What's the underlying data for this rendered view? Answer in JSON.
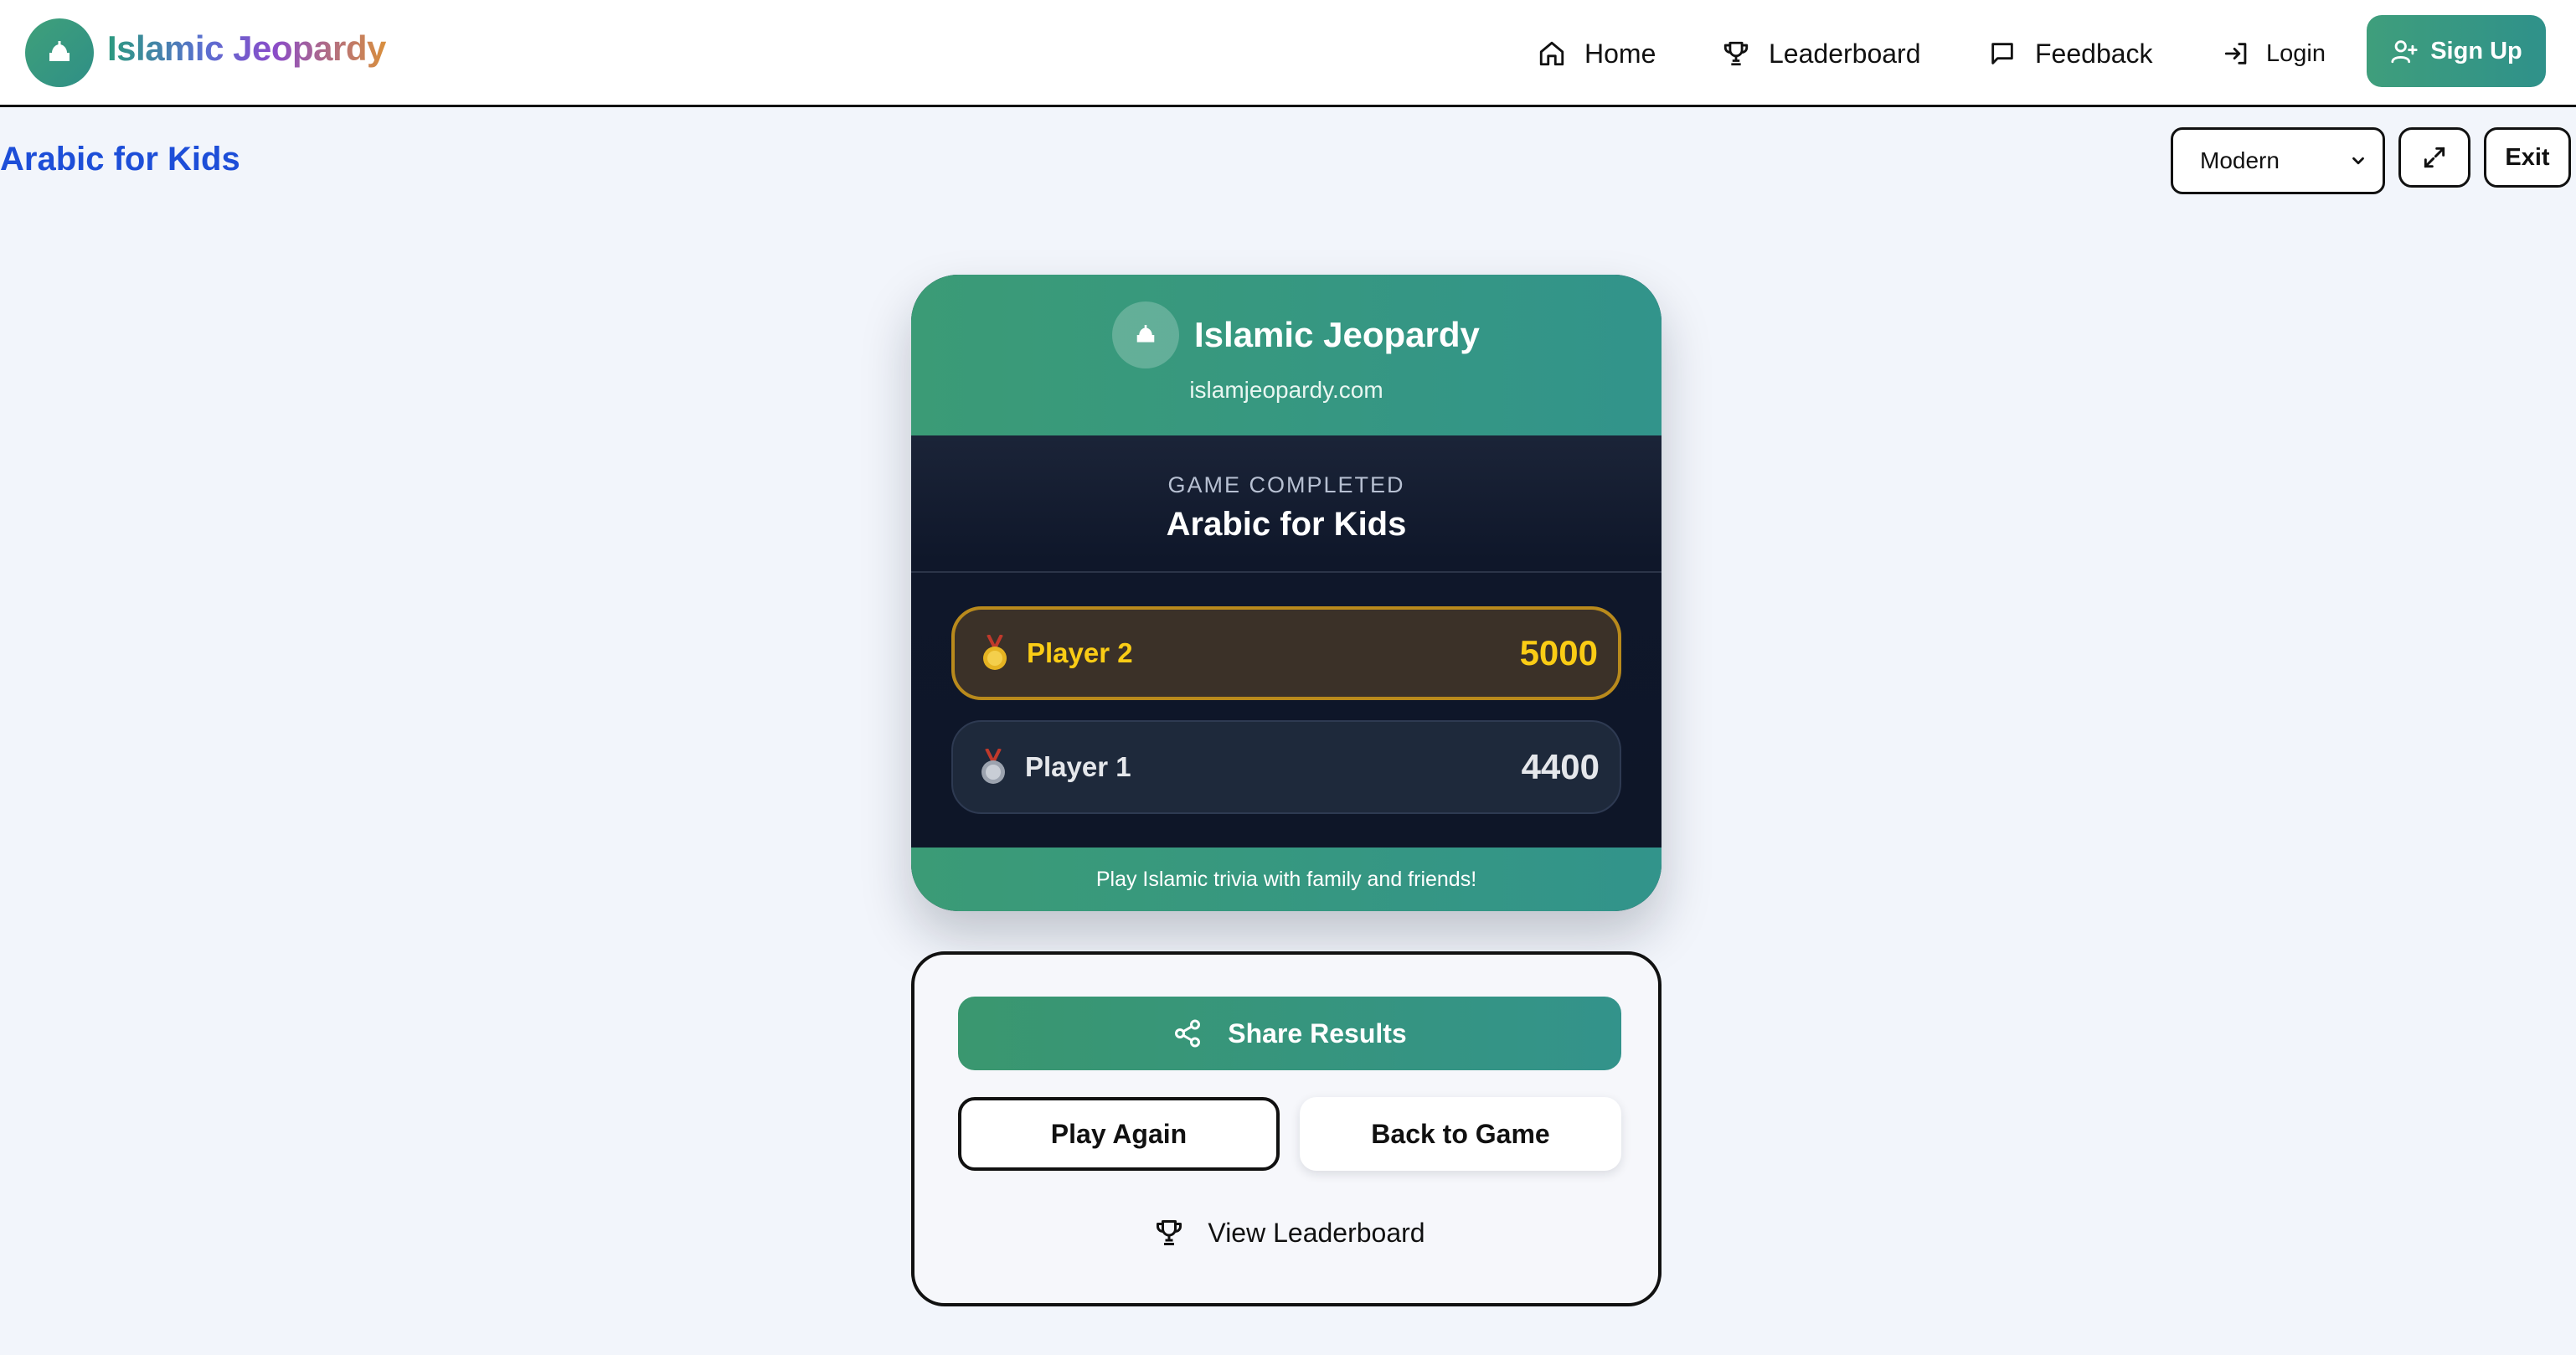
{
  "header": {
    "brand": "Islamic Jeopardy",
    "logo_icon": "mosque-icon",
    "nav": [
      {
        "label": "Home",
        "icon": "home-icon"
      },
      {
        "label": "Leaderboard",
        "icon": "trophy-icon"
      },
      {
        "label": "Feedback",
        "icon": "message-icon"
      },
      {
        "label": "Login",
        "icon": "login-icon"
      }
    ],
    "signup_label": "Sign Up"
  },
  "toolbar": {
    "page_title": "Arabic for Kids",
    "theme_selected": "Modern",
    "exit_label": "Exit"
  },
  "result_card": {
    "brand": "Islamic Jeopardy",
    "site": "islamjeopardy.com",
    "status": "GAME COMPLETED",
    "game_title": "Arabic for Kids",
    "players": [
      {
        "rank": 1,
        "name": "Player 2",
        "score": "5000",
        "medal": "gold-medal-icon"
      },
      {
        "rank": 2,
        "name": "Player 1",
        "score": "4400",
        "medal": "silver-medal-icon"
      }
    ],
    "footer": "Play Islamic trivia with family and friends!"
  },
  "actions": {
    "share_label": "Share Results",
    "play_again_label": "Play Again",
    "back_label": "Back to Game",
    "leaderboard_label": "View Leaderboard"
  },
  "colors": {
    "brand_green": "#3b9b76",
    "title_blue": "#1d4ed8",
    "gold": "#facc15",
    "card_dark": "#0f172a"
  }
}
